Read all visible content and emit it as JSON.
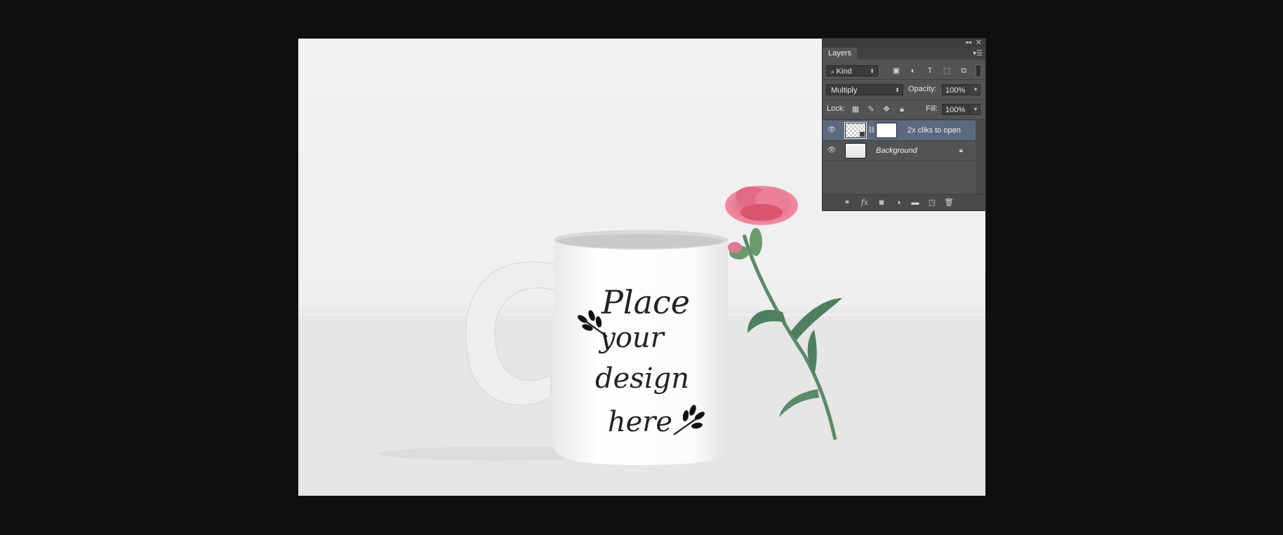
{
  "canvas": {
    "mug_text": [
      "Place",
      "your",
      "design",
      "here"
    ]
  },
  "panel": {
    "collapse_icon": "double-left-arrow-icon",
    "close_icon": "close-icon",
    "tab_label": "Layers",
    "filter": {
      "label": "Kind",
      "icons": [
        "image-filter-icon",
        "adjustment-filter-icon",
        "type-filter-icon",
        "shape-filter-icon",
        "smart-object-filter-icon"
      ]
    },
    "blend_mode": "Multiply",
    "opacity_label": "Opacity:",
    "opacity_value": "100%",
    "lock_label": "Lock:",
    "fill_label": "Fill:",
    "fill_value": "100%",
    "layers": [
      {
        "name": "2x cliks to open",
        "selected": true,
        "visible": true
      },
      {
        "name": "Background",
        "selected": false,
        "visible": true,
        "locked": true
      }
    ],
    "footer_icons": [
      "link-icon",
      "fx-icon",
      "mask-icon",
      "adjustment-icon",
      "folder-icon",
      "new-layer-icon",
      "trash-icon"
    ]
  }
}
